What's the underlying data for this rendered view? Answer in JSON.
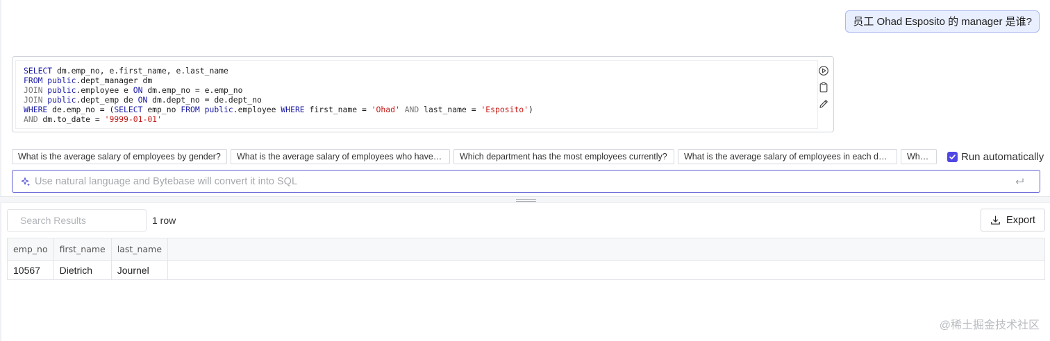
{
  "chat": {
    "user_question": "员工 Ohad Esposito 的 manager 是谁?"
  },
  "sql": {
    "lines": [
      [
        {
          "t": "SELECT",
          "c": "kw"
        },
        {
          "t": " dm.emp_no, e.first_name, e.last_name",
          "c": ""
        }
      ],
      [
        {
          "t": "FROM",
          "c": "kw"
        },
        {
          "t": " ",
          "c": ""
        },
        {
          "t": "public",
          "c": "kw"
        },
        {
          "t": ".dept_manager dm",
          "c": ""
        }
      ],
      [
        {
          "t": "JOIN",
          "c": "kw2"
        },
        {
          "t": " ",
          "c": ""
        },
        {
          "t": "public",
          "c": "kw"
        },
        {
          "t": ".employee e ",
          "c": ""
        },
        {
          "t": "ON",
          "c": "kw"
        },
        {
          "t": " dm.emp_no = e.emp_no",
          "c": ""
        }
      ],
      [
        {
          "t": "JOIN",
          "c": "kw2"
        },
        {
          "t": " ",
          "c": ""
        },
        {
          "t": "public",
          "c": "kw"
        },
        {
          "t": ".dept_emp de ",
          "c": ""
        },
        {
          "t": "ON",
          "c": "kw"
        },
        {
          "t": " dm.dept_no = de.dept_no",
          "c": ""
        }
      ],
      [
        {
          "t": "WHERE",
          "c": "kw"
        },
        {
          "t": " de.emp_no = (",
          "c": ""
        },
        {
          "t": "SELECT",
          "c": "kw"
        },
        {
          "t": " emp_no ",
          "c": ""
        },
        {
          "t": "FROM",
          "c": "kw"
        },
        {
          "t": " ",
          "c": ""
        },
        {
          "t": "public",
          "c": "kw"
        },
        {
          "t": ".employee ",
          "c": ""
        },
        {
          "t": "WHERE",
          "c": "kw"
        },
        {
          "t": " first_name = ",
          "c": ""
        },
        {
          "t": "'Ohad'",
          "c": "str"
        },
        {
          "t": " ",
          "c": ""
        },
        {
          "t": "AND",
          "c": "kw2"
        },
        {
          "t": " last_name = ",
          "c": ""
        },
        {
          "t": "'Esposito'",
          "c": "str"
        },
        {
          "t": ")",
          "c": ""
        }
      ],
      [
        {
          "t": "AND",
          "c": "kw2"
        },
        {
          "t": " dm.to_date = ",
          "c": ""
        },
        {
          "t": "'9999-01-01'",
          "c": "str"
        }
      ]
    ],
    "tools": [
      "run-icon",
      "copy-icon",
      "edit-icon"
    ]
  },
  "suggestions": [
    {
      "label": "What is the average salary of employees by gender?",
      "width": 310
    },
    {
      "label": "What is the average salary of employees who have been with the company",
      "width": 316
    },
    {
      "label": "Which department has the most employees currently?",
      "width": 318
    },
    {
      "label": "What is the average salary of employees in each department?",
      "width": 316
    },
    {
      "label": "Which employee has the highest salary?",
      "width": 52
    }
  ],
  "run_automatically": {
    "label": "Run automatically",
    "checked": true
  },
  "nl_input": {
    "placeholder": "Use natural language and Bytebase will convert it into SQL",
    "value": ""
  },
  "results": {
    "search_placeholder": "Search Results",
    "row_count": "1 row",
    "export_label": "Export",
    "columns": [
      "emp_no",
      "first_name",
      "last_name"
    ],
    "rows": [
      [
        "10567",
        "Dietrich",
        "Journel"
      ]
    ]
  },
  "watermark": "@稀土掘金技术社区"
}
